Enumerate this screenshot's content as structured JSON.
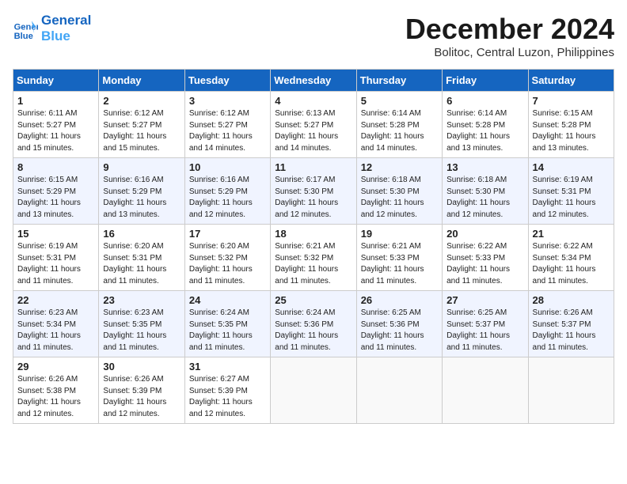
{
  "header": {
    "logo_line1": "General",
    "logo_line2": "Blue",
    "month_title": "December 2024",
    "location": "Bolitoc, Central Luzon, Philippines"
  },
  "weekdays": [
    "Sunday",
    "Monday",
    "Tuesday",
    "Wednesday",
    "Thursday",
    "Friday",
    "Saturday"
  ],
  "weeks": [
    [
      {
        "day": "1",
        "sunrise": "6:11 AM",
        "sunset": "5:27 PM",
        "daylight": "11 hours and 15 minutes."
      },
      {
        "day": "2",
        "sunrise": "6:12 AM",
        "sunset": "5:27 PM",
        "daylight": "11 hours and 15 minutes."
      },
      {
        "day": "3",
        "sunrise": "6:12 AM",
        "sunset": "5:27 PM",
        "daylight": "11 hours and 14 minutes."
      },
      {
        "day": "4",
        "sunrise": "6:13 AM",
        "sunset": "5:27 PM",
        "daylight": "11 hours and 14 minutes."
      },
      {
        "day": "5",
        "sunrise": "6:14 AM",
        "sunset": "5:28 PM",
        "daylight": "11 hours and 14 minutes."
      },
      {
        "day": "6",
        "sunrise": "6:14 AM",
        "sunset": "5:28 PM",
        "daylight": "11 hours and 13 minutes."
      },
      {
        "day": "7",
        "sunrise": "6:15 AM",
        "sunset": "5:28 PM",
        "daylight": "11 hours and 13 minutes."
      }
    ],
    [
      {
        "day": "8",
        "sunrise": "6:15 AM",
        "sunset": "5:29 PM",
        "daylight": "11 hours and 13 minutes."
      },
      {
        "day": "9",
        "sunrise": "6:16 AM",
        "sunset": "5:29 PM",
        "daylight": "11 hours and 13 minutes."
      },
      {
        "day": "10",
        "sunrise": "6:16 AM",
        "sunset": "5:29 PM",
        "daylight": "11 hours and 12 minutes."
      },
      {
        "day": "11",
        "sunrise": "6:17 AM",
        "sunset": "5:30 PM",
        "daylight": "11 hours and 12 minutes."
      },
      {
        "day": "12",
        "sunrise": "6:18 AM",
        "sunset": "5:30 PM",
        "daylight": "11 hours and 12 minutes."
      },
      {
        "day": "13",
        "sunrise": "6:18 AM",
        "sunset": "5:30 PM",
        "daylight": "11 hours and 12 minutes."
      },
      {
        "day": "14",
        "sunrise": "6:19 AM",
        "sunset": "5:31 PM",
        "daylight": "11 hours and 12 minutes."
      }
    ],
    [
      {
        "day": "15",
        "sunrise": "6:19 AM",
        "sunset": "5:31 PM",
        "daylight": "11 hours and 11 minutes."
      },
      {
        "day": "16",
        "sunrise": "6:20 AM",
        "sunset": "5:31 PM",
        "daylight": "11 hours and 11 minutes."
      },
      {
        "day": "17",
        "sunrise": "6:20 AM",
        "sunset": "5:32 PM",
        "daylight": "11 hours and 11 minutes."
      },
      {
        "day": "18",
        "sunrise": "6:21 AM",
        "sunset": "5:32 PM",
        "daylight": "11 hours and 11 minutes."
      },
      {
        "day": "19",
        "sunrise": "6:21 AM",
        "sunset": "5:33 PM",
        "daylight": "11 hours and 11 minutes."
      },
      {
        "day": "20",
        "sunrise": "6:22 AM",
        "sunset": "5:33 PM",
        "daylight": "11 hours and 11 minutes."
      },
      {
        "day": "21",
        "sunrise": "6:22 AM",
        "sunset": "5:34 PM",
        "daylight": "11 hours and 11 minutes."
      }
    ],
    [
      {
        "day": "22",
        "sunrise": "6:23 AM",
        "sunset": "5:34 PM",
        "daylight": "11 hours and 11 minutes."
      },
      {
        "day": "23",
        "sunrise": "6:23 AM",
        "sunset": "5:35 PM",
        "daylight": "11 hours and 11 minutes."
      },
      {
        "day": "24",
        "sunrise": "6:24 AM",
        "sunset": "5:35 PM",
        "daylight": "11 hours and 11 minutes."
      },
      {
        "day": "25",
        "sunrise": "6:24 AM",
        "sunset": "5:36 PM",
        "daylight": "11 hours and 11 minutes."
      },
      {
        "day": "26",
        "sunrise": "6:25 AM",
        "sunset": "5:36 PM",
        "daylight": "11 hours and 11 minutes."
      },
      {
        "day": "27",
        "sunrise": "6:25 AM",
        "sunset": "5:37 PM",
        "daylight": "11 hours and 11 minutes."
      },
      {
        "day": "28",
        "sunrise": "6:26 AM",
        "sunset": "5:37 PM",
        "daylight": "11 hours and 11 minutes."
      }
    ],
    [
      {
        "day": "29",
        "sunrise": "6:26 AM",
        "sunset": "5:38 PM",
        "daylight": "11 hours and 12 minutes."
      },
      {
        "day": "30",
        "sunrise": "6:26 AM",
        "sunset": "5:39 PM",
        "daylight": "11 hours and 12 minutes."
      },
      {
        "day": "31",
        "sunrise": "6:27 AM",
        "sunset": "5:39 PM",
        "daylight": "11 hours and 12 minutes."
      },
      null,
      null,
      null,
      null
    ]
  ],
  "labels": {
    "sunrise": "Sunrise:",
    "sunset": "Sunset:",
    "daylight": "Daylight hours"
  }
}
